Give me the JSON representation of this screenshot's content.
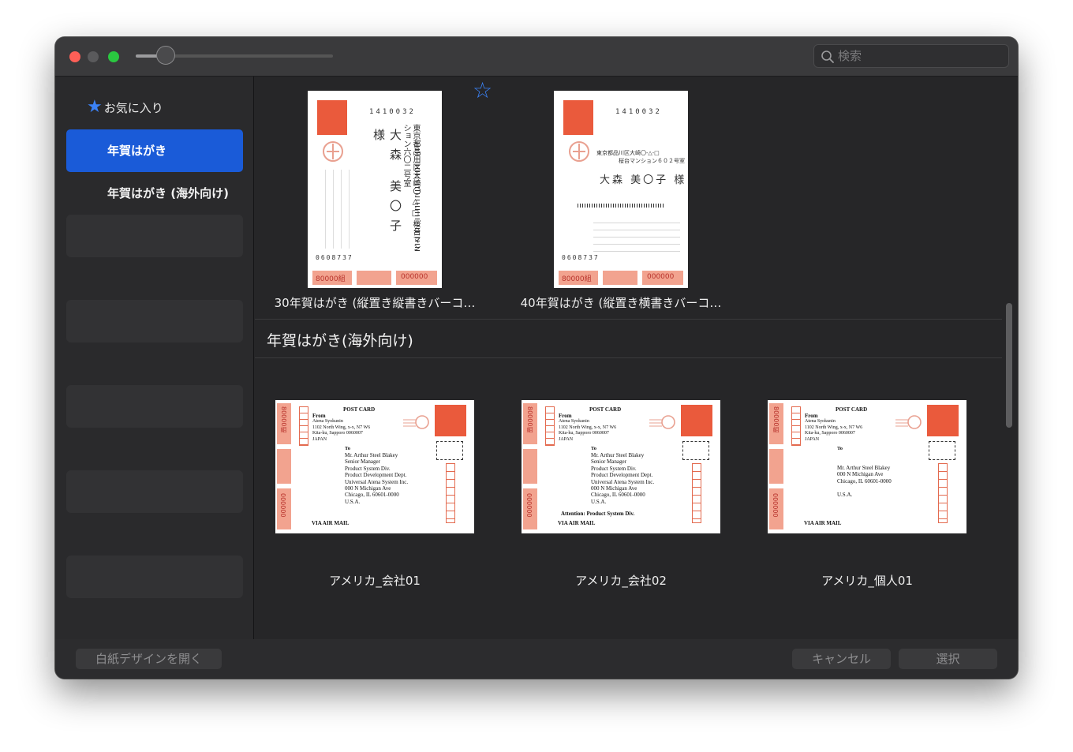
{
  "window": {
    "title": "",
    "search": {
      "placeholder": "検索",
      "value": ""
    },
    "zoom_slider": {
      "value_fraction": 0.15
    }
  },
  "sidebar": {
    "favorites_label": "お気に入り",
    "items": [
      {
        "label": "年賀はがき",
        "selected": true
      },
      {
        "label": "年賀はがき (海外向け)",
        "selected": false
      }
    ]
  },
  "main": {
    "nenga_cards": [
      {
        "caption": "30年賀はがき (縦置き縦書きバーコ…",
        "postal_code": "1410032",
        "return_code": "0608737",
        "stamp_value": "80000組",
        "lottery_number": "000000",
        "name": "大森 美〇子 様",
        "address": "東京都品川区大崎〇-△-□ 桜台マンション六〇二号室"
      },
      {
        "caption": "40年賀はがき (縦置き横書きバーコ…",
        "postal_code": "1410032",
        "return_code": "0608737",
        "stamp_value": "80000組",
        "lottery_number": "000000",
        "name": "大森 美〇子 様",
        "address_line1": "東京都品川区大崎〇-△-□",
        "address_line2": "桜台マンション６０２号室"
      }
    ],
    "section_title": "年賀はがき(海外向け)",
    "postcards": [
      {
        "caption": "アメリカ_会社01",
        "header": "POST CARD",
        "from_label": "From",
        "from_lines": [
          "Atena Syokunin",
          "1102 North Wing, x-x, N7 W6",
          "Kita-ku, Sapporo 0060007",
          "JAPAN"
        ],
        "to_label": "To",
        "to_lines": [
          "Mr.   Arthur  Steel  Blakey",
          "Senior Manager",
          "Product System Div.",
          "Product Development Dept.",
          "Universal Atena System Inc.",
          "000 N Michigan Ave",
          "Chicago, IL 60601-0000",
          "U.S.A."
        ],
        "attention": "",
        "footer": "VIA AIR MAIL",
        "stamp_label": "80000組",
        "lottery": "000000"
      },
      {
        "caption": "アメリカ_会社02",
        "header": "POST CARD",
        "from_label": "From",
        "from_lines": [
          "Atena Syokunin",
          "1102 North Wing, x-x, N7 W6",
          "Kita-ku, Sapporo 0060007",
          "JAPAN"
        ],
        "to_label": "To",
        "to_lines": [
          "Mr.   Arthur  Steel  Blakey",
          "Senior Manager",
          "Product System Div.",
          "Product Development Dept.",
          "Universal Atena System Inc.",
          "000 N Michigan Ave",
          "Chicago, IL 60601-0000",
          "U.S.A."
        ],
        "attention": "Attention:  Product System Div.",
        "footer": "VIA AIR MAIL",
        "stamp_label": "80000組",
        "lottery": "000000"
      },
      {
        "caption": "アメリカ_個人01",
        "header": "POST CARD",
        "from_label": "From",
        "from_lines": [
          "Atena Syokunin",
          "1102 North Wing, x-x, N7 W6",
          "Kita-ku, Sapporo 0060007",
          "JAPAN"
        ],
        "to_label": "To",
        "to_lines": [
          "Mr.   Arthur  Steel  Blakey",
          "000 N Michigan Ave",
          "Chicago, IL 60601-0000",
          "",
          "U.S.A."
        ],
        "attention": "",
        "footer": "VIA AIR MAIL",
        "stamp_label": "80000組",
        "lottery": "000000"
      }
    ]
  },
  "footer": {
    "open_blank_label": "白紙デザインを開く",
    "cancel_label": "キャンセル",
    "select_label": "選択"
  },
  "colors": {
    "accent": "#1a5bd8",
    "favorite_star": "#3b82f6",
    "stamp_red": "#ea5a3c"
  }
}
